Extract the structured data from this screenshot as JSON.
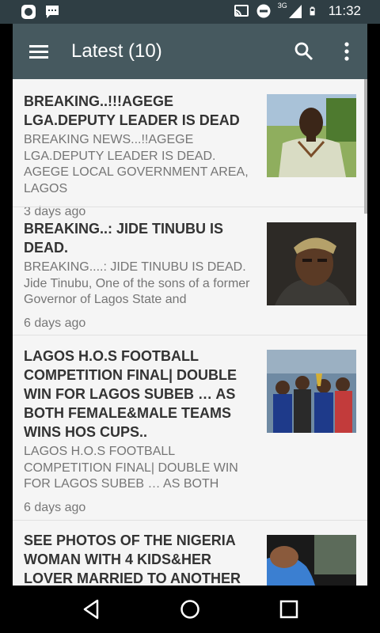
{
  "status_bar": {
    "time": "11:32",
    "network": "3G",
    "icons": [
      "app-notification-icon",
      "message-icon",
      "cast-icon",
      "do-not-disturb-icon",
      "signal-icon",
      "battery-icon"
    ]
  },
  "toolbar": {
    "title": "Latest (10)",
    "icons": [
      "menu-icon",
      "search-icon",
      "more-vert-icon"
    ]
  },
  "articles": [
    {
      "title": "BREAKING..!!!AGEGE LGA.DEPUTY LEADER IS DEAD",
      "excerpt": "BREAKING NEWS...!!AGEGE LGA.DEPUTY LEADER IS DEAD. AGEGE LOCAL GOVERNMENT AREA, LAGOS",
      "date": "3 days ago"
    },
    {
      "title": "BREAKING..:  JIDE TINUBU IS DEAD.",
      "excerpt": "BREAKING....: JIDE TINUBU IS DEAD. Jide Tinubu, One of the sons of a former Governor of Lagos State and",
      "date": "6 days ago"
    },
    {
      "title": "LAGOS H.O.S FOOTBALL COMPETITION FINAL| DOUBLE WIN FOR LAGOS SUBEB … AS BOTH FEMALE&MALE TEAMS WINS HOS CUPS..",
      "excerpt": "LAGOS H.O.S FOOTBALL COMPETITION FINAL| DOUBLE WIN FOR LAGOS SUBEB … AS BOTH",
      "date": "6 days ago"
    },
    {
      "title": "SEE PHOTOS OF THE NIGERIA WOMAN WITH 4 KIDS&HER LOVER MARRIED TO ANOTHER",
      "excerpt": "",
      "date": ""
    }
  ],
  "nav_bar": {
    "icons": [
      "back-icon",
      "home-icon",
      "recents-icon"
    ]
  },
  "colors": {
    "status_bar": "#2f3e44",
    "toolbar": "#46595f",
    "background": "#f5f5f5",
    "title_text": "#333333",
    "body_text": "#757575"
  }
}
